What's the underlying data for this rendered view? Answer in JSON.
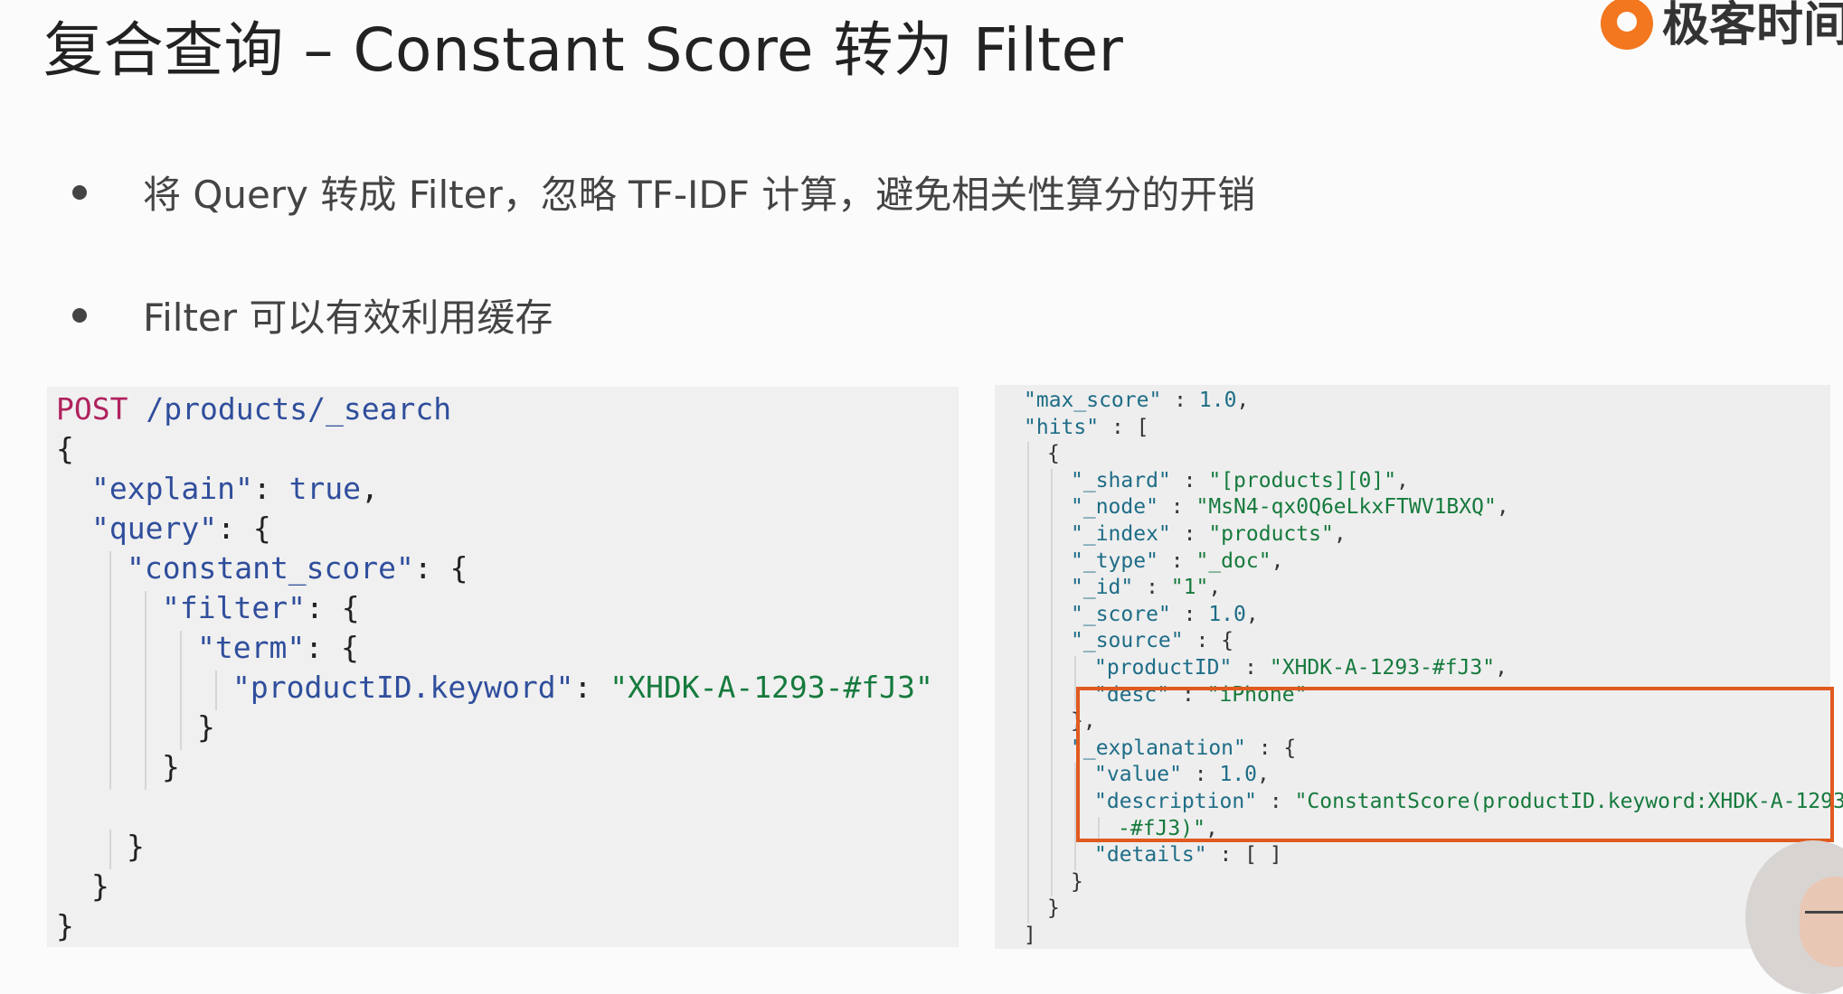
{
  "slide": {
    "title": "复合查询 – Constant Score 转为 Filter",
    "logo_text": "极客时间",
    "bullets": [
      "将 Query 转成 Filter，忽略 TF-IDF 计算，避免相关性算分的开销",
      "Filter 可以有效利用缓存"
    ]
  },
  "request": {
    "method": "POST",
    "path": "/products/_search",
    "lines": [
      {
        "i": 0,
        "tokens": [
          [
            "punc",
            "{"
          ]
        ]
      },
      {
        "i": 1,
        "tokens": [
          [
            "key",
            "\"explain\""
          ],
          [
            "punc",
            ": "
          ],
          [
            "bool",
            "true"
          ],
          [
            "punc",
            ","
          ]
        ]
      },
      {
        "i": 1,
        "tokens": [
          [
            "key",
            "\"query\""
          ],
          [
            "punc",
            ": {"
          ]
        ]
      },
      {
        "i": 2,
        "tokens": [
          [
            "key",
            "\"constant_score\""
          ],
          [
            "punc",
            ": {"
          ]
        ]
      },
      {
        "i": 3,
        "tokens": [
          [
            "key",
            "\"filter\""
          ],
          [
            "punc",
            ": {"
          ]
        ]
      },
      {
        "i": 4,
        "tokens": [
          [
            "key",
            "\"term\""
          ],
          [
            "punc",
            ": {"
          ]
        ]
      },
      {
        "i": 5,
        "tokens": [
          [
            "key",
            "\"productID.keyword\""
          ],
          [
            "punc",
            ": "
          ],
          [
            "str",
            "\"XHDK-A-1293-#fJ3\""
          ]
        ]
      },
      {
        "i": 4,
        "tokens": [
          [
            "punc",
            "}"
          ]
        ]
      },
      {
        "i": 3,
        "tokens": [
          [
            "punc",
            "}"
          ]
        ]
      },
      {
        "i": 0,
        "tokens": []
      },
      {
        "i": 2,
        "tokens": [
          [
            "punc",
            "}"
          ]
        ]
      },
      {
        "i": 1,
        "tokens": [
          [
            "punc",
            "}"
          ]
        ]
      },
      {
        "i": 0,
        "tokens": [
          [
            "punc",
            "}"
          ]
        ]
      }
    ]
  },
  "response": {
    "lines": [
      {
        "i": 1,
        "tokens": [
          [
            "rk",
            "\"max_score\""
          ],
          [
            "rp",
            " : "
          ],
          [
            "rn",
            "1.0"
          ],
          [
            "rp",
            ","
          ]
        ]
      },
      {
        "i": 1,
        "tokens": [
          [
            "rk",
            "\"hits\""
          ],
          [
            "rp",
            " : ["
          ]
        ]
      },
      {
        "i": 2,
        "tokens": [
          [
            "rp",
            "{"
          ]
        ]
      },
      {
        "i": 3,
        "tokens": [
          [
            "rk",
            "\"_shard\""
          ],
          [
            "rp",
            " : "
          ],
          [
            "rs",
            "\"[products][0]\""
          ],
          [
            "rp",
            ","
          ]
        ]
      },
      {
        "i": 3,
        "tokens": [
          [
            "rk",
            "\"_node\""
          ],
          [
            "rp",
            " : "
          ],
          [
            "rs",
            "\"MsN4-qx0Q6eLkxFTWV1BXQ\""
          ],
          [
            "rp",
            ","
          ]
        ]
      },
      {
        "i": 3,
        "tokens": [
          [
            "rk",
            "\"_index\""
          ],
          [
            "rp",
            " : "
          ],
          [
            "rs",
            "\"products\""
          ],
          [
            "rp",
            ","
          ]
        ]
      },
      {
        "i": 3,
        "tokens": [
          [
            "rk",
            "\"_type\""
          ],
          [
            "rp",
            " : "
          ],
          [
            "rs",
            "\"_doc\""
          ],
          [
            "rp",
            ","
          ]
        ]
      },
      {
        "i": 3,
        "tokens": [
          [
            "rk",
            "\"_id\""
          ],
          [
            "rp",
            " : "
          ],
          [
            "rs",
            "\"1\""
          ],
          [
            "rp",
            ","
          ]
        ]
      },
      {
        "i": 3,
        "tokens": [
          [
            "rk",
            "\"_score\""
          ],
          [
            "rp",
            " : "
          ],
          [
            "rn",
            "1.0"
          ],
          [
            "rp",
            ","
          ]
        ]
      },
      {
        "i": 3,
        "tokens": [
          [
            "rk",
            "\"_source\""
          ],
          [
            "rp",
            " : {"
          ]
        ]
      },
      {
        "i": 4,
        "tokens": [
          [
            "rk",
            "\"productID\""
          ],
          [
            "rp",
            " : "
          ],
          [
            "rs",
            "\"XHDK-A-1293-#fJ3\""
          ],
          [
            "rp",
            ","
          ]
        ]
      },
      {
        "i": 4,
        "tokens": [
          [
            "rk",
            "\"desc\""
          ],
          [
            "rp",
            " : "
          ],
          [
            "rs",
            "\"iPhone\""
          ]
        ]
      },
      {
        "i": 3,
        "tokens": [
          [
            "rp",
            "},"
          ]
        ]
      },
      {
        "i": 3,
        "tokens": [
          [
            "rk",
            "\"_explanation\""
          ],
          [
            "rp",
            " : {"
          ]
        ]
      },
      {
        "i": 4,
        "tokens": [
          [
            "rk",
            "\"value\""
          ],
          [
            "rp",
            " : "
          ],
          [
            "rn",
            "1.0"
          ],
          [
            "rp",
            ","
          ]
        ]
      },
      {
        "i": 4,
        "tokens": [
          [
            "rk",
            "\"description\""
          ],
          [
            "rp",
            " : "
          ],
          [
            "rs",
            "\"ConstantScore(productID.keyword:XHDK-A-1293"
          ]
        ]
      },
      {
        "i": 5,
        "tokens": [
          [
            "rs",
            "-#fJ3)\""
          ],
          [
            "rp",
            ","
          ]
        ]
      },
      {
        "i": 4,
        "tokens": [
          [
            "rk",
            "\"details\""
          ],
          [
            "rp",
            " : [ ]"
          ]
        ]
      },
      {
        "i": 3,
        "tokens": [
          [
            "rp",
            "}"
          ]
        ]
      },
      {
        "i": 2,
        "tokens": [
          [
            "rp",
            "}"
          ]
        ]
      },
      {
        "i": 1,
        "tokens": [
          [
            "rp",
            "]"
          ]
        ]
      }
    ]
  }
}
